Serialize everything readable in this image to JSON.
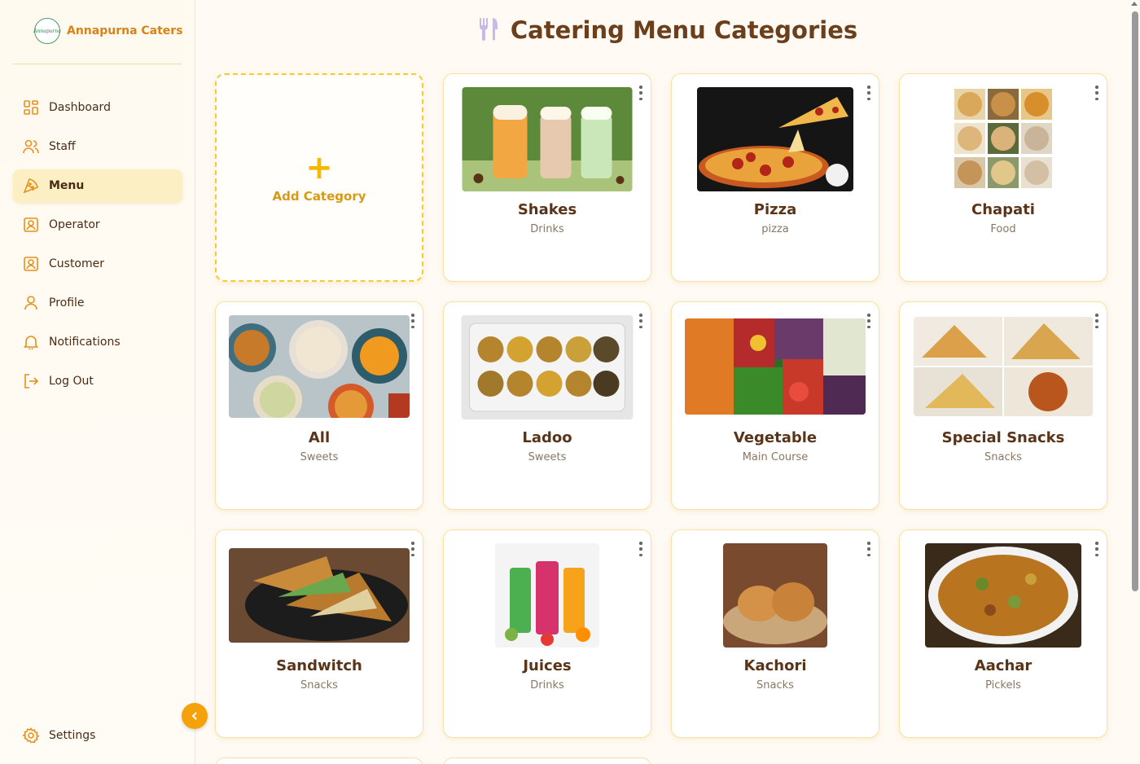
{
  "brand": {
    "name": "Annapurna Caters",
    "logo_text": "Annapurna"
  },
  "nav": [
    {
      "label": "Dashboard",
      "icon": "dashboard-icon",
      "active": false
    },
    {
      "label": "Staff",
      "icon": "users-icon",
      "active": false
    },
    {
      "label": "Menu",
      "icon": "pizza-icon",
      "active": true
    },
    {
      "label": "Operator",
      "icon": "badge-icon",
      "active": false
    },
    {
      "label": "Customer",
      "icon": "badge-icon",
      "active": false
    },
    {
      "label": "Profile",
      "icon": "user-icon",
      "active": false
    },
    {
      "label": "Notifications",
      "icon": "bell-icon",
      "active": false
    },
    {
      "label": "Log Out",
      "icon": "logout-icon",
      "active": false
    }
  ],
  "settings": {
    "label": "Settings",
    "icon": "gear-icon"
  },
  "page": {
    "title": "Catering Menu Categories",
    "title_icon": "fork-knife-icon"
  },
  "add_card": {
    "plus": "+",
    "label": "Add Category"
  },
  "categories": [
    {
      "name": "Shakes",
      "type": "Drinks"
    },
    {
      "name": "Pizza",
      "type": "pizza"
    },
    {
      "name": "Chapati",
      "type": "Food"
    },
    {
      "name": "All",
      "type": "Sweets"
    },
    {
      "name": "Ladoo",
      "type": "Sweets"
    },
    {
      "name": "Vegetable",
      "type": "Main Course"
    },
    {
      "name": "Special Snacks",
      "type": "Snacks"
    },
    {
      "name": "Sandwitch",
      "type": "Snacks"
    },
    {
      "name": "Juices",
      "type": "Drinks"
    },
    {
      "name": "Kachori",
      "type": "Snacks"
    },
    {
      "name": "Aachar",
      "type": "Pickels"
    }
  ],
  "colors": {
    "accent": "#f5a20a",
    "brand": "#d9821a",
    "active_bg": "#fdefc4",
    "card_border": "#f7e1a2"
  }
}
